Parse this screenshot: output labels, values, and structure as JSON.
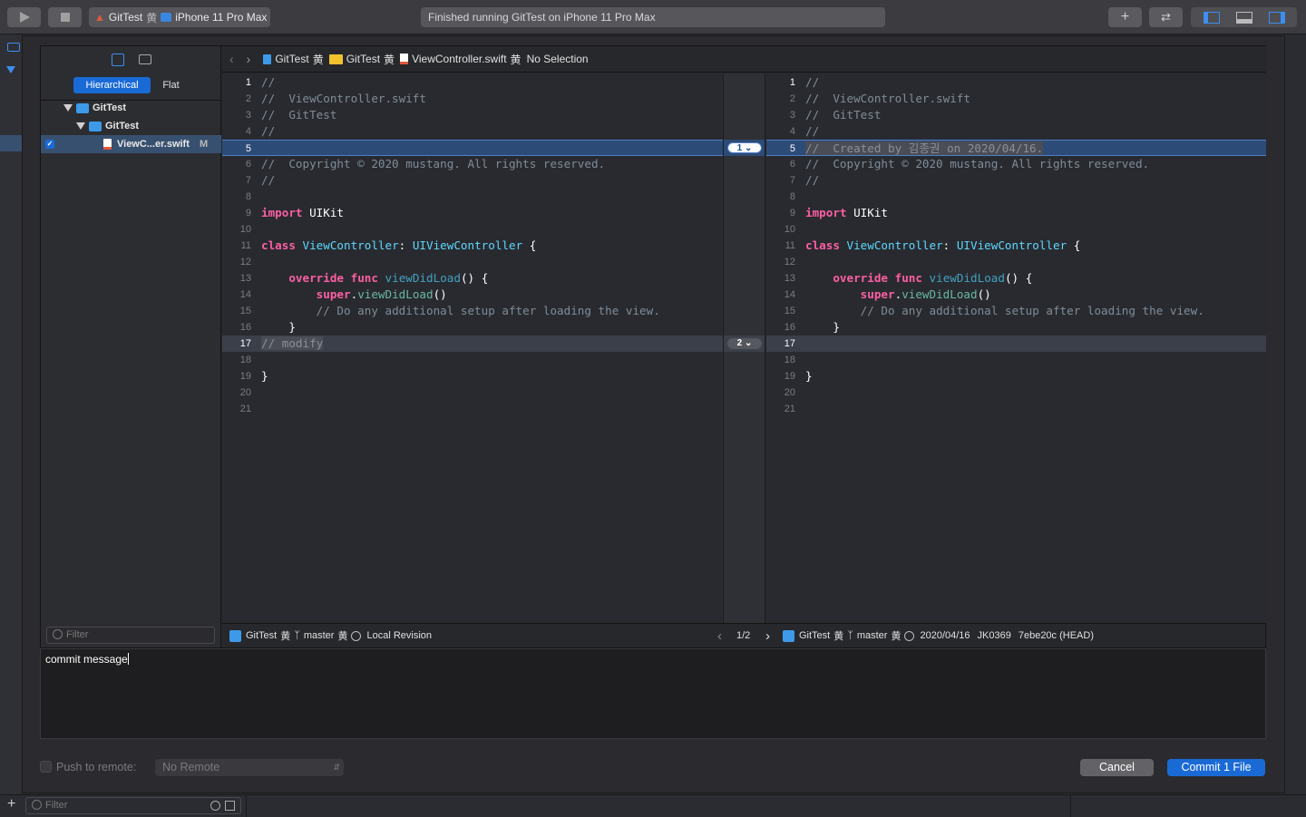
{
  "toolbar": {
    "scheme_project": "GitTest",
    "scheme_device": "iPhone 11 Pro Max",
    "activity_status": "Finished running GitTest on iPhone 11 Pro Max"
  },
  "navigator": {
    "tabs": [
      "Hierarchical",
      "Flat"
    ],
    "tree": [
      {
        "label": "GitTest"
      },
      {
        "label": "GitTest"
      },
      {
        "label": "ViewC...er.swift",
        "status": "M"
      }
    ],
    "filter_placeholder": "Filter"
  },
  "jumpbar": {
    "crumbs": [
      "GitTest",
      "GitTest",
      "ViewController.swift",
      "No Selection"
    ]
  },
  "left_pane": {
    "lines": [
      {
        "n": "1",
        "t": "//"
      },
      {
        "n": "2",
        "t": "//  ViewController.swift"
      },
      {
        "n": "3",
        "t": "//  GitTest"
      },
      {
        "n": "4",
        "t": "//"
      },
      {
        "n": "5",
        "t": ""
      },
      {
        "n": "6",
        "t": "//  Copyright © 2020 mustang. All rights reserved."
      },
      {
        "n": "7",
        "t": "//"
      },
      {
        "n": "8",
        "t": ""
      },
      {
        "n": "9",
        "t": "import UIKit"
      },
      {
        "n": "10",
        "t": ""
      },
      {
        "n": "11",
        "t": "class ViewController: UIViewController {"
      },
      {
        "n": "12",
        "t": ""
      },
      {
        "n": "13",
        "t": "    override func viewDidLoad() {"
      },
      {
        "n": "14",
        "t": "        super.viewDidLoad()"
      },
      {
        "n": "15",
        "t": "        // Do any additional setup after loading the view."
      },
      {
        "n": "16",
        "t": "    }"
      },
      {
        "n": "17",
        "t": "// modify"
      },
      {
        "n": "18",
        "t": ""
      },
      {
        "n": "19",
        "t": "}"
      },
      {
        "n": "20",
        "t": ""
      },
      {
        "n": "21",
        "t": ""
      }
    ]
  },
  "right_pane": {
    "lines": [
      {
        "n": "1",
        "t": "//"
      },
      {
        "n": "2",
        "t": "//  ViewController.swift"
      },
      {
        "n": "3",
        "t": "//  GitTest"
      },
      {
        "n": "4",
        "t": "//"
      },
      {
        "n": "5",
        "t": "//  Created by 김종권 on 2020/04/16."
      },
      {
        "n": "6",
        "t": "//  Copyright © 2020 mustang. All rights reserved."
      },
      {
        "n": "7",
        "t": "//"
      },
      {
        "n": "8",
        "t": ""
      },
      {
        "n": "9",
        "t": "import UIKit"
      },
      {
        "n": "10",
        "t": ""
      },
      {
        "n": "11",
        "t": "class ViewController: UIViewController {"
      },
      {
        "n": "12",
        "t": ""
      },
      {
        "n": "13",
        "t": "    override func viewDidLoad() {"
      },
      {
        "n": "14",
        "t": "        super.viewDidLoad()"
      },
      {
        "n": "15",
        "t": "        // Do any additional setup after loading the view."
      },
      {
        "n": "16",
        "t": "    }"
      },
      {
        "n": "17",
        "t": ""
      },
      {
        "n": "18",
        "t": ""
      },
      {
        "n": "19",
        "t": "}"
      },
      {
        "n": "20",
        "t": ""
      },
      {
        "n": "21",
        "t": ""
      }
    ]
  },
  "changes": [
    {
      "label": "1",
      "line": 5
    },
    {
      "label": "2",
      "line": 17
    }
  ],
  "footer": {
    "left_project": "GitTest",
    "left_branch": "master",
    "left_revision": "Local Revision",
    "pager": "1/2",
    "right_project": "GitTest",
    "right_branch": "master",
    "right_date": "2020/04/16",
    "right_author": "JK0369",
    "right_commit": "7ebe20c (HEAD)"
  },
  "commit_message": "commit message",
  "bottom": {
    "push_label": "Push to remote:",
    "remote_value": "No Remote",
    "cancel_label": "Cancel",
    "commit_label": "Commit 1 File",
    "filter_placeholder": "Filter"
  },
  "colors": {
    "accent": "#1a6ad6",
    "change_blue": "#2d4b77",
    "change_gray": "#3b3f4a"
  }
}
